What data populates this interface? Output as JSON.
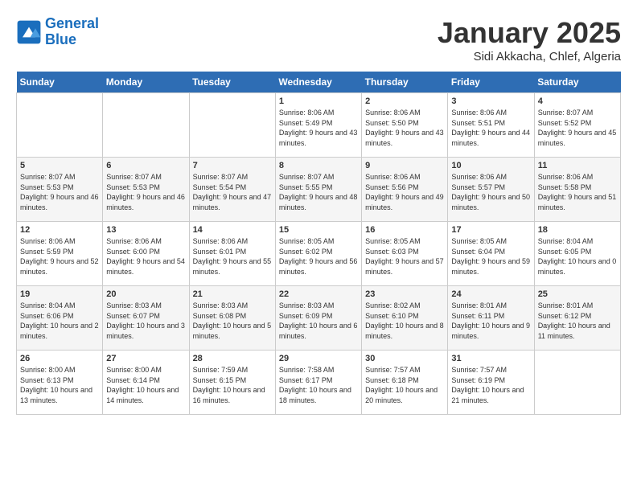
{
  "logo": {
    "line1": "General",
    "line2": "Blue"
  },
  "title": "January 2025",
  "subtitle": "Sidi Akkacha, Chlef, Algeria",
  "weekdays": [
    "Sunday",
    "Monday",
    "Tuesday",
    "Wednesday",
    "Thursday",
    "Friday",
    "Saturday"
  ],
  "weeks": [
    [
      {
        "day": null,
        "info": null
      },
      {
        "day": null,
        "info": null
      },
      {
        "day": null,
        "info": null
      },
      {
        "day": "1",
        "info": "Sunrise: 8:06 AM\nSunset: 5:49 PM\nDaylight: 9 hours and 43 minutes."
      },
      {
        "day": "2",
        "info": "Sunrise: 8:06 AM\nSunset: 5:50 PM\nDaylight: 9 hours and 43 minutes."
      },
      {
        "day": "3",
        "info": "Sunrise: 8:06 AM\nSunset: 5:51 PM\nDaylight: 9 hours and 44 minutes."
      },
      {
        "day": "4",
        "info": "Sunrise: 8:07 AM\nSunset: 5:52 PM\nDaylight: 9 hours and 45 minutes."
      }
    ],
    [
      {
        "day": "5",
        "info": "Sunrise: 8:07 AM\nSunset: 5:53 PM\nDaylight: 9 hours and 46 minutes."
      },
      {
        "day": "6",
        "info": "Sunrise: 8:07 AM\nSunset: 5:53 PM\nDaylight: 9 hours and 46 minutes."
      },
      {
        "day": "7",
        "info": "Sunrise: 8:07 AM\nSunset: 5:54 PM\nDaylight: 9 hours and 47 minutes."
      },
      {
        "day": "8",
        "info": "Sunrise: 8:07 AM\nSunset: 5:55 PM\nDaylight: 9 hours and 48 minutes."
      },
      {
        "day": "9",
        "info": "Sunrise: 8:06 AM\nSunset: 5:56 PM\nDaylight: 9 hours and 49 minutes."
      },
      {
        "day": "10",
        "info": "Sunrise: 8:06 AM\nSunset: 5:57 PM\nDaylight: 9 hours and 50 minutes."
      },
      {
        "day": "11",
        "info": "Sunrise: 8:06 AM\nSunset: 5:58 PM\nDaylight: 9 hours and 51 minutes."
      }
    ],
    [
      {
        "day": "12",
        "info": "Sunrise: 8:06 AM\nSunset: 5:59 PM\nDaylight: 9 hours and 52 minutes."
      },
      {
        "day": "13",
        "info": "Sunrise: 8:06 AM\nSunset: 6:00 PM\nDaylight: 9 hours and 54 minutes."
      },
      {
        "day": "14",
        "info": "Sunrise: 8:06 AM\nSunset: 6:01 PM\nDaylight: 9 hours and 55 minutes."
      },
      {
        "day": "15",
        "info": "Sunrise: 8:05 AM\nSunset: 6:02 PM\nDaylight: 9 hours and 56 minutes."
      },
      {
        "day": "16",
        "info": "Sunrise: 8:05 AM\nSunset: 6:03 PM\nDaylight: 9 hours and 57 minutes."
      },
      {
        "day": "17",
        "info": "Sunrise: 8:05 AM\nSunset: 6:04 PM\nDaylight: 9 hours and 59 minutes."
      },
      {
        "day": "18",
        "info": "Sunrise: 8:04 AM\nSunset: 6:05 PM\nDaylight: 10 hours and 0 minutes."
      }
    ],
    [
      {
        "day": "19",
        "info": "Sunrise: 8:04 AM\nSunset: 6:06 PM\nDaylight: 10 hours and 2 minutes."
      },
      {
        "day": "20",
        "info": "Sunrise: 8:03 AM\nSunset: 6:07 PM\nDaylight: 10 hours and 3 minutes."
      },
      {
        "day": "21",
        "info": "Sunrise: 8:03 AM\nSunset: 6:08 PM\nDaylight: 10 hours and 5 minutes."
      },
      {
        "day": "22",
        "info": "Sunrise: 8:03 AM\nSunset: 6:09 PM\nDaylight: 10 hours and 6 minutes."
      },
      {
        "day": "23",
        "info": "Sunrise: 8:02 AM\nSunset: 6:10 PM\nDaylight: 10 hours and 8 minutes."
      },
      {
        "day": "24",
        "info": "Sunrise: 8:01 AM\nSunset: 6:11 PM\nDaylight: 10 hours and 9 minutes."
      },
      {
        "day": "25",
        "info": "Sunrise: 8:01 AM\nSunset: 6:12 PM\nDaylight: 10 hours and 11 minutes."
      }
    ],
    [
      {
        "day": "26",
        "info": "Sunrise: 8:00 AM\nSunset: 6:13 PM\nDaylight: 10 hours and 13 minutes."
      },
      {
        "day": "27",
        "info": "Sunrise: 8:00 AM\nSunset: 6:14 PM\nDaylight: 10 hours and 14 minutes."
      },
      {
        "day": "28",
        "info": "Sunrise: 7:59 AM\nSunset: 6:15 PM\nDaylight: 10 hours and 16 minutes."
      },
      {
        "day": "29",
        "info": "Sunrise: 7:58 AM\nSunset: 6:17 PM\nDaylight: 10 hours and 18 minutes."
      },
      {
        "day": "30",
        "info": "Sunrise: 7:57 AM\nSunset: 6:18 PM\nDaylight: 10 hours and 20 minutes."
      },
      {
        "day": "31",
        "info": "Sunrise: 7:57 AM\nSunset: 6:19 PM\nDaylight: 10 hours and 21 minutes."
      },
      {
        "day": null,
        "info": null
      }
    ]
  ]
}
